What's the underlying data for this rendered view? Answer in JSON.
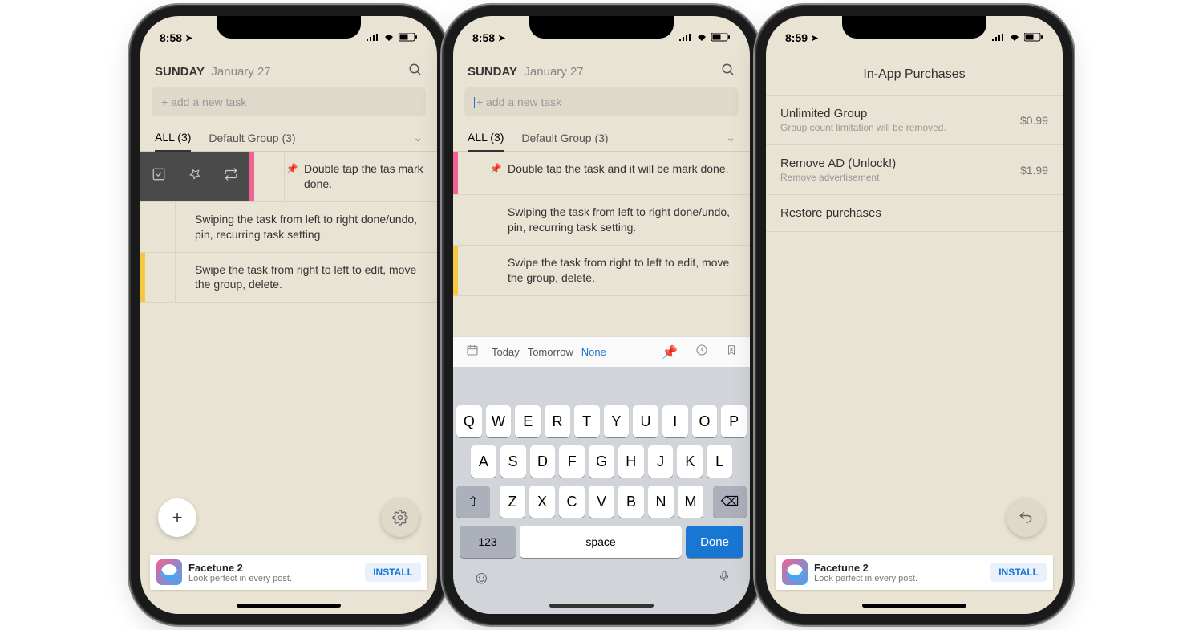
{
  "status": {
    "time1": "8:58",
    "time2": "8:58",
    "time3": "8:59"
  },
  "header": {
    "day": "SUNDAY",
    "date": "January 27"
  },
  "input": {
    "placeholder": "+ add a new task"
  },
  "tabs": {
    "all": "ALL (3)",
    "default_group": "Default Group (3)"
  },
  "tasks": [
    {
      "text": "Double tap the task and it will be mark done.",
      "pinned": true,
      "color": "pink"
    },
    {
      "text": "Swiping the task from left to right done/undo, pin, recurring task setting.",
      "pinned": false,
      "color": ""
    },
    {
      "text": "Swipe the task from right to left to edit, move the group, delete.",
      "pinned": false,
      "color": "yellow"
    }
  ],
  "task0_short": "Double tap the tas mark done.",
  "kb_toolbar": {
    "today": "Today",
    "tomorrow": "Tomorrow",
    "none": "None"
  },
  "keyboard": {
    "row1": [
      "Q",
      "W",
      "E",
      "R",
      "T",
      "Y",
      "U",
      "I",
      "O",
      "P"
    ],
    "row2": [
      "A",
      "S",
      "D",
      "F",
      "G",
      "H",
      "J",
      "K",
      "L"
    ],
    "row3": [
      "Z",
      "X",
      "C",
      "V",
      "B",
      "N",
      "M"
    ],
    "num": "123",
    "space": "space",
    "done": "Done"
  },
  "iap": {
    "title": "In-App Purchases",
    "items": [
      {
        "name": "Unlimited Group",
        "desc": "Group count limitation will be removed.",
        "price": "$0.99"
      },
      {
        "name": "Remove AD (Unlock!)",
        "desc": "Remove advertisement",
        "price": "$1.99"
      }
    ],
    "restore": "Restore purchases"
  },
  "ad": {
    "title": "Facetune 2",
    "subtitle": "Look perfect in every post.",
    "button": "INSTALL"
  }
}
